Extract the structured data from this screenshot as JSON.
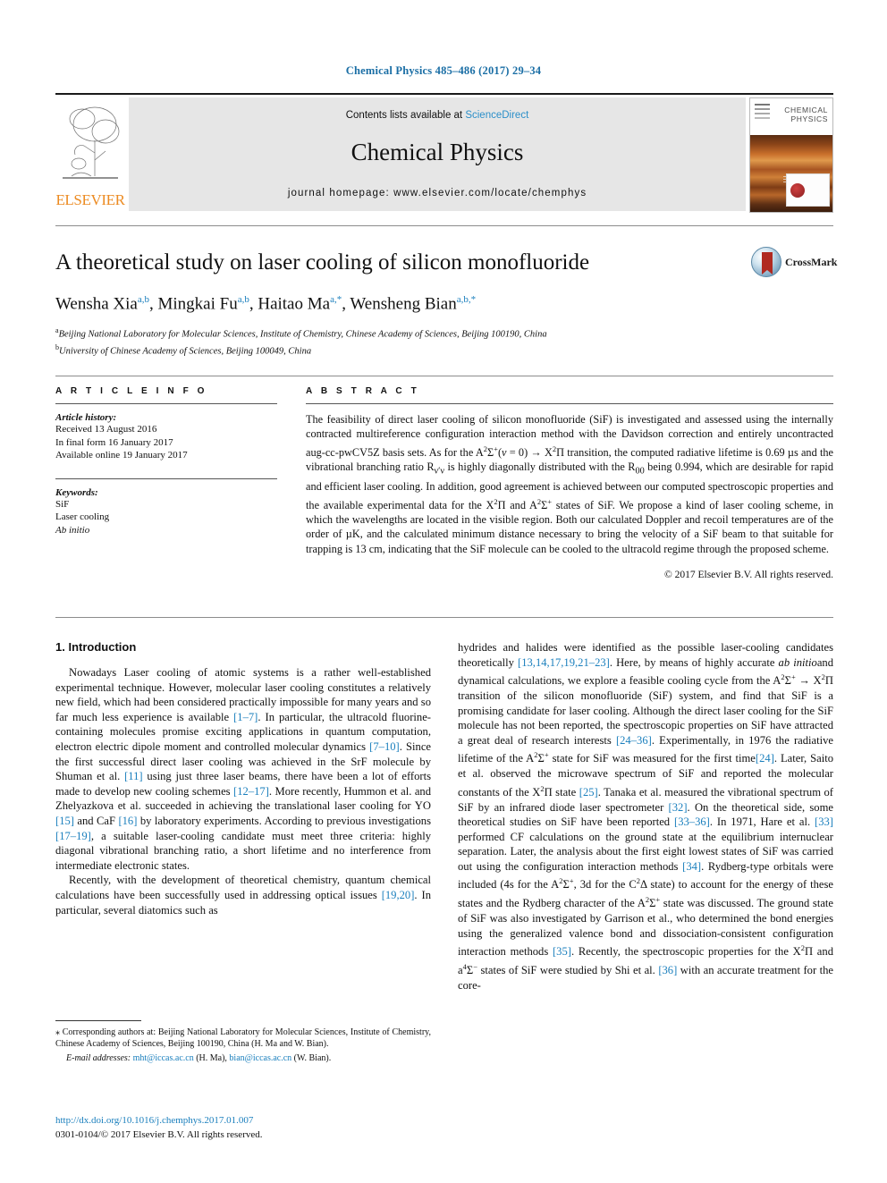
{
  "running_head": "Chemical Physics 485–486 (2017) 29–34",
  "masthead": {
    "publisher": "ELSEVIER",
    "contents_prefix": "Contents lists available at ",
    "contents_link": "ScienceDirect",
    "journal_title": "Chemical Physics",
    "homepage": "journal homepage: www.elsevier.com/locate/chemphys",
    "cover_title_line1": "CHEMICAL",
    "cover_title_line2": "PHYSICS"
  },
  "article": {
    "title": "A theoretical study on laser cooling of silicon monofluoride",
    "authors": [
      {
        "name": "Wensha Xia",
        "sup": "a,b"
      },
      {
        "name": "Mingkai Fu",
        "sup": "a,b"
      },
      {
        "name": "Haitao Ma",
        "sup": "a,*"
      },
      {
        "name": "Wensheng Bian",
        "sup": "a,b,*"
      }
    ],
    "affiliations": [
      {
        "marker": "a",
        "text": "Beijing National Laboratory for Molecular Sciences, Institute of Chemistry, Chinese Academy of Sciences, Beijing 100190, China"
      },
      {
        "marker": "b",
        "text": "University of Chinese Academy of Sciences, Beijing 100049, China"
      }
    ],
    "crossmark_label": "CrossMark"
  },
  "info": {
    "heading": "A R T I C L E   I N F O",
    "history_label": "Article history:",
    "history": [
      "Received 13 August 2016",
      "In final form 16 January 2017",
      "Available online 19 January 2017"
    ],
    "keywords_label": "Keywords:",
    "keywords": [
      "SiF",
      "Laser cooling"
    ],
    "keywords_italic": [
      "Ab initio"
    ]
  },
  "abstract": {
    "heading": "A B S T R A C T",
    "text": "The feasibility of direct laser cooling of silicon monofluoride (SiF) is investigated and assessed using the internally contracted multireference configuration interaction method with the Davidson correction and entirely uncontracted aug-cc-pwCV5Z basis sets. As for the A2Σ+(ν = 0) → X2Π transition, the computed radiative lifetime is 0.69 μs and the vibrational branching ratio Rν′ν is highly diagonally distributed with the R00 being 0.994, which are desirable for rapid and efficient laser cooling. In addition, good agreement is achieved between our computed spectroscopic properties and the available experimental data for the X2Π and A2Σ+ states of SiF. We propose a kind of laser cooling scheme, in which the wavelengths are located in the visible region. Both our calculated Doppler and recoil temperatures are of the order of μK, and the calculated minimum distance necessary to bring the velocity of a SiF beam to that suitable for trapping is 13 cm, indicating that the SiF molecule can be cooled to the ultracold regime through the proposed scheme.",
    "copyright": "© 2017 Elsevier B.V. All rights reserved."
  },
  "body": {
    "section_heading": "1. Introduction",
    "left_paragraph_1_a": "Nowadays Laser cooling of atomic systems is a rather well-established experimental technique. However, molecular laser cooling constitutes a relatively new field, which had been considered practically impossible for many years and so far much less experience is available ",
    "ref_1_7": "[1–7]",
    "left_paragraph_1_b": ". In particular, the ultracold fluorine-containing molecules promise exciting applications in quantum computation, electron electric dipole moment and controlled molecular dynamics ",
    "ref_7_10": "[7–10]",
    "left_paragraph_1_c": ". Since the first successful direct laser cooling was achieved in the SrF molecule by Shuman et al. ",
    "ref_11": "[11]",
    "left_paragraph_1_d": " using just three laser beams, there have been a lot of efforts made to develop new cooling schemes ",
    "ref_12_17": "[12–17]",
    "left_paragraph_1_e": ". More recently, Hummon et al. and Zhelyazkova et al. succeeded in achieving the translational laser cooling for YO ",
    "ref_15": "[15]",
    "left_paragraph_1_f": " and CaF ",
    "ref_16": "[16]",
    "left_paragraph_1_g": " by laboratory experiments. According to previous investigations ",
    "ref_17_19": "[17–19]",
    "left_paragraph_1_h": ", a suitable laser-cooling candidate must meet three criteria: highly diagonal vibrational branching ratio, a short lifetime and no interference from intermediate electronic states.",
    "left_paragraph_2_a": "Recently, with the development of theoretical chemistry, quantum chemical calculations have been successfully used in addressing optical issues ",
    "ref_19_20": "[19,20]",
    "left_paragraph_2_b": ". In particular, several diatomics such as",
    "right_paragraph_a": "hydrides and halides were identified as the possible laser-cooling candidates theoretically ",
    "ref_13_23": "[13,14,17,19,21–23]",
    "right_paragraph_b": ". Here, by means of highly accurate ab initioand dynamical calculations, we explore a feasible cooling cycle from the A2Σ+ → X2Π transition of the silicon monofluoride (SiF) system, and find that SiF is a promising candidate for laser cooling. Although the direct laser cooling for the SiF molecule has not been reported, the spectroscopic properties on SiF have attracted a great deal of research interests ",
    "ref_24_36": "[24–36]",
    "right_paragraph_c": ". Experimentally, in 1976 the radiative lifetime of the A2Σ+ state for SiF was measured for the first time",
    "ref_24": "[24]",
    "right_paragraph_d": ". Later, Saito et al. observed the microwave spectrum of SiF and reported the molecular constants of the X2Π state ",
    "ref_25": "[25]",
    "right_paragraph_e": ". Tanaka et al. measured the vibrational spectrum of SiF by an infrared diode laser spectrometer ",
    "ref_32": "[32]",
    "right_paragraph_f": ". On the theoretical side, some theoretical studies on SiF have been reported ",
    "ref_33_36": "[33–36]",
    "right_paragraph_g": ". In 1971, Hare et al. ",
    "ref_33": "[33]",
    "right_paragraph_h": " performed CF calculations on the ground state at the equilibrium internuclear separation. Later, the analysis about the first eight lowest states of SiF was carried out using the configuration interaction methods ",
    "ref_34": "[34]",
    "right_paragraph_i": ". Rydberg-type orbitals were included (4s for the A2Σ+, 3d for the C2Δ state) to account for the energy of these states and the Rydberg character of the A2Σ+ state was discussed. The ground state of SiF was also investigated by Garrison et al., who determined the bond energies using the generalized valence bond and dissociation-consistent configuration interaction methods ",
    "ref_35": "[35]",
    "right_paragraph_j": ". Recently, the spectroscopic properties for the X2Π and a4Σ− states of SiF were studied by Shi et al. ",
    "ref_36": "[36]",
    "right_paragraph_k": " with an accurate treatment for the core-"
  },
  "footnotes": {
    "corresponding_marker": "⁎",
    "corresponding_text": " Corresponding authors at: Beijing National Laboratory for Molecular Sciences, Institute of Chemistry, Chinese Academy of Sciences, Beijing 100190, China (H. Ma and W. Bian).",
    "email_label": "E-mail addresses:",
    "email_1": "mht@iccas.ac.cn",
    "email_1_owner": " (H. Ma), ",
    "email_2": "bian@iccas.ac.cn",
    "email_2_owner": " (W. Bian).",
    "doi": "http://dx.doi.org/10.1016/j.chemphys.2017.01.007",
    "issn_line": "0301-0104/© 2017 Elsevier B.V. All rights reserved."
  },
  "colors": {
    "link_blue": "#1a7fbd",
    "elsevier_orange": "#ec8b22",
    "crossmark_red": "#b02a22"
  }
}
